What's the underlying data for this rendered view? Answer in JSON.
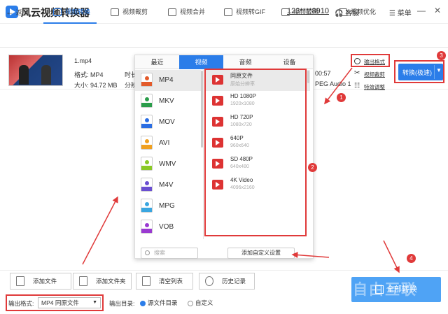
{
  "app": {
    "title": "风云视频转换器",
    "account": "123****8910",
    "service": "客服",
    "menu": "菜单"
  },
  "nav": {
    "back": "返回",
    "items": [
      "视频转换",
      "视频裁剪",
      "视频合并",
      "视频转GIF",
      "视频截图",
      "视频优化"
    ],
    "active": 0
  },
  "file": {
    "name": "1.mp4",
    "format_label": "格式: MP4",
    "size_label": "大小: 94.72 MB",
    "partial_left1": "时长",
    "partial_left2": "分辨",
    "partial_right1": "00:57",
    "partial_right2": "PEG Audio 1"
  },
  "actions": {
    "output_format": "输出格式",
    "video_crop": "视频裁剪",
    "effects": "特效调整",
    "convert": "转换(极速)"
  },
  "panel": {
    "tabs": [
      "最近",
      "视频",
      "音频",
      "设备"
    ],
    "active_tab": 1,
    "formats": [
      {
        "label": "MP4",
        "color": "#e35a2a"
      },
      {
        "label": "MKV",
        "color": "#2a9d4a"
      },
      {
        "label": "MOV",
        "color": "#2a6de3"
      },
      {
        "label": "AVI",
        "color": "#f0a020"
      },
      {
        "label": "WMV",
        "color": "#8ac926"
      },
      {
        "label": "M4V",
        "color": "#6a4fd1"
      },
      {
        "label": "MPG",
        "color": "#3aa6e0"
      },
      {
        "label": "VOB",
        "color": "#9a3ad1"
      }
    ],
    "resolutions": [
      {
        "name": "同原文件",
        "sub": "原始分辨率"
      },
      {
        "name": "HD 1080P",
        "sub": "1920x1080"
      },
      {
        "name": "HD 720P",
        "sub": "1080x720"
      },
      {
        "name": "640P",
        "sub": "960x640"
      },
      {
        "name": "SD 480P",
        "sub": "640x480"
      },
      {
        "name": "4K Video",
        "sub": "4096x2160"
      }
    ],
    "search_placeholder": "搜索",
    "custom_button": "添加自定义设置"
  },
  "bottom": {
    "add_file": "添加文件",
    "add_folder": "添加文件夹",
    "clear": "清空列表",
    "history": "历史记录",
    "output_format_label": "输出格式:",
    "output_format_value": "MP4 同原文件",
    "output_dir_label": "输出目录:",
    "source_dir": "源文件目录",
    "custom_dir": "自定义",
    "convert_all": "全部转换",
    "watermark": "自由互联"
  },
  "annotations": {
    "b1": "1",
    "b2": "2",
    "b3": "3",
    "b4": "4"
  },
  "colors": {
    "accent": "#2b7de9",
    "annotation": "#e03a3a"
  }
}
